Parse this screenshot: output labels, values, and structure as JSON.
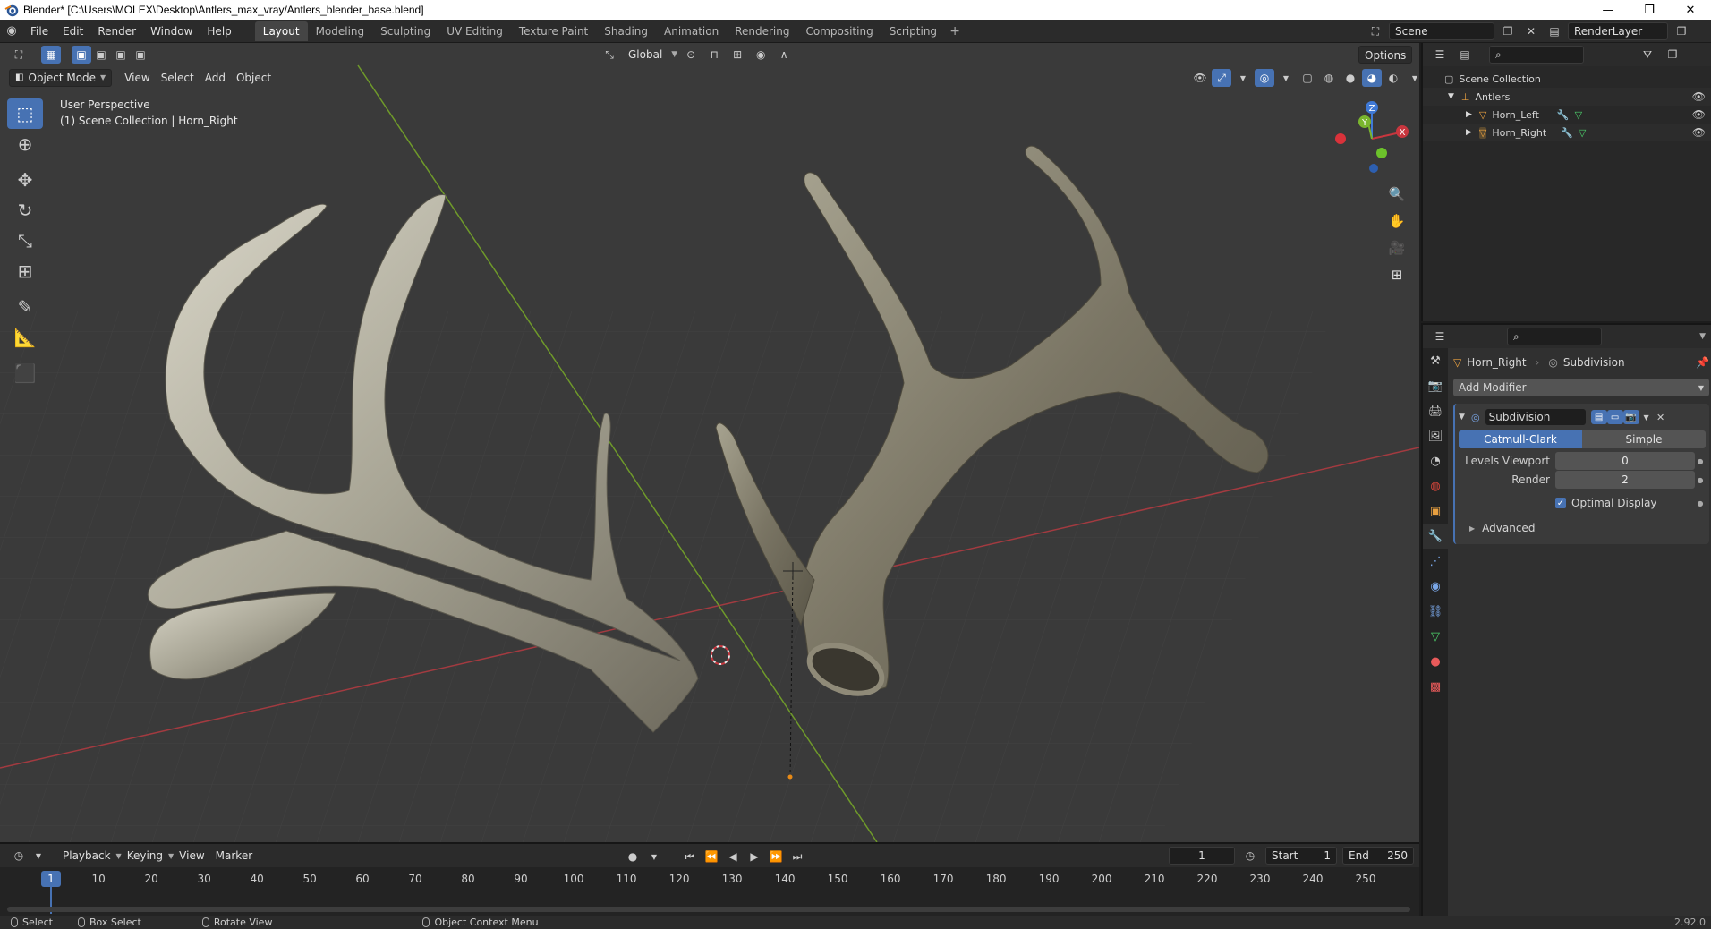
{
  "window": {
    "title": "Blender* [C:\\Users\\MOLEX\\Desktop\\Antlers_max_vray/Antlers_blender_base.blend]",
    "controls": [
      "—",
      "❐",
      "✕"
    ]
  },
  "menus": [
    "File",
    "Edit",
    "Render",
    "Window",
    "Help"
  ],
  "workspaces": [
    {
      "label": "Layout",
      "active": true
    },
    {
      "label": "Modeling"
    },
    {
      "label": "Sculpting"
    },
    {
      "label": "UV Editing"
    },
    {
      "label": "Texture Paint"
    },
    {
      "label": "Shading"
    },
    {
      "label": "Animation"
    },
    {
      "label": "Rendering"
    },
    {
      "label": "Compositing"
    },
    {
      "label": "Scripting"
    }
  ],
  "scene": {
    "name": "Scene",
    "render_layer": "RenderLayer"
  },
  "viewport": {
    "mode": "Object Mode",
    "menus": [
      "View",
      "Select",
      "Add",
      "Object"
    ],
    "transform_orientation": "Global",
    "options_label": "Options",
    "info_perspective": "User Perspective",
    "info_collection": "(1) Scene Collection | Horn_Right",
    "gizmo": {
      "x": "X",
      "y": "Y",
      "z": "Z"
    }
  },
  "outliner": {
    "root": "Scene Collection",
    "collection": "Antlers",
    "objects": [
      "Horn_Left",
      "Horn_Right"
    ]
  },
  "properties": {
    "object_name": "Horn_Right",
    "modifier_name": "Subdivision",
    "add_modifier": "Add Modifier",
    "modifier_field": "Subdivision",
    "algo_catmull": "Catmull-Clark",
    "algo_simple": "Simple",
    "levels_viewport_label": "Levels Viewport",
    "levels_viewport": "0",
    "render_label": "Render",
    "render_value": "2",
    "optimal_display": "Optimal Display",
    "advanced": "Advanced"
  },
  "timeline": {
    "menus": [
      "Playback",
      "Keying",
      "View",
      "Marker"
    ],
    "current_frame": "1",
    "start_label": "Start",
    "start": "1",
    "end_label": "End",
    "end": "250",
    "ticks": [
      "10",
      "20",
      "30",
      "40",
      "50",
      "60",
      "70",
      "80",
      "90",
      "100",
      "110",
      "120",
      "130",
      "140",
      "150",
      "160",
      "170",
      "180",
      "190",
      "200",
      "210",
      "220",
      "230",
      "240",
      "250"
    ],
    "playhead": "1"
  },
  "status": {
    "select": "Select",
    "box_select": "Box Select",
    "rotate_view": "Rotate View",
    "context_menu": "Object Context Menu",
    "version": "2.92.0"
  },
  "colors": {
    "accent": "#4772b3",
    "x_axis": "#c8363e",
    "y_axis": "#7ab52e",
    "z_axis": "#3f79d6"
  }
}
